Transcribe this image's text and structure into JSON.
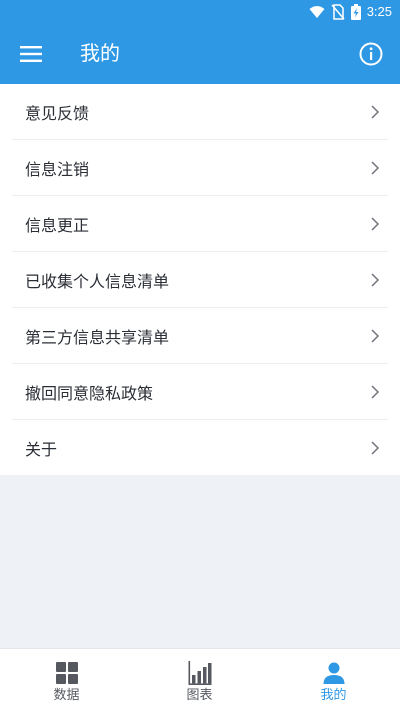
{
  "status_bar": {
    "time": "3:25",
    "icons": [
      "wifi-icon",
      "no-sim-icon",
      "battery-charging-icon"
    ]
  },
  "app_bar": {
    "title": "我的",
    "left_icon": "menu-icon",
    "right_icon": "info-icon"
  },
  "menu": {
    "items": [
      {
        "label": "意见反馈"
      },
      {
        "label": "信息注销"
      },
      {
        "label": "信息更正"
      },
      {
        "label": "已收集个人信息清单"
      },
      {
        "label": "第三方信息共享清单"
      },
      {
        "label": "撤回同意隐私政策"
      },
      {
        "label": "关于"
      }
    ]
  },
  "bottom_nav": {
    "items": [
      {
        "label": "数据",
        "icon": "grid-icon",
        "active": false
      },
      {
        "label": "图表",
        "icon": "bar-chart-icon",
        "active": false
      },
      {
        "label": "我的",
        "icon": "person-icon",
        "active": true
      }
    ]
  },
  "colors": {
    "primary": "#2f98e4",
    "background": "#eef2f6",
    "text": "#2a2e35",
    "inactive_nav": "#55595f"
  }
}
